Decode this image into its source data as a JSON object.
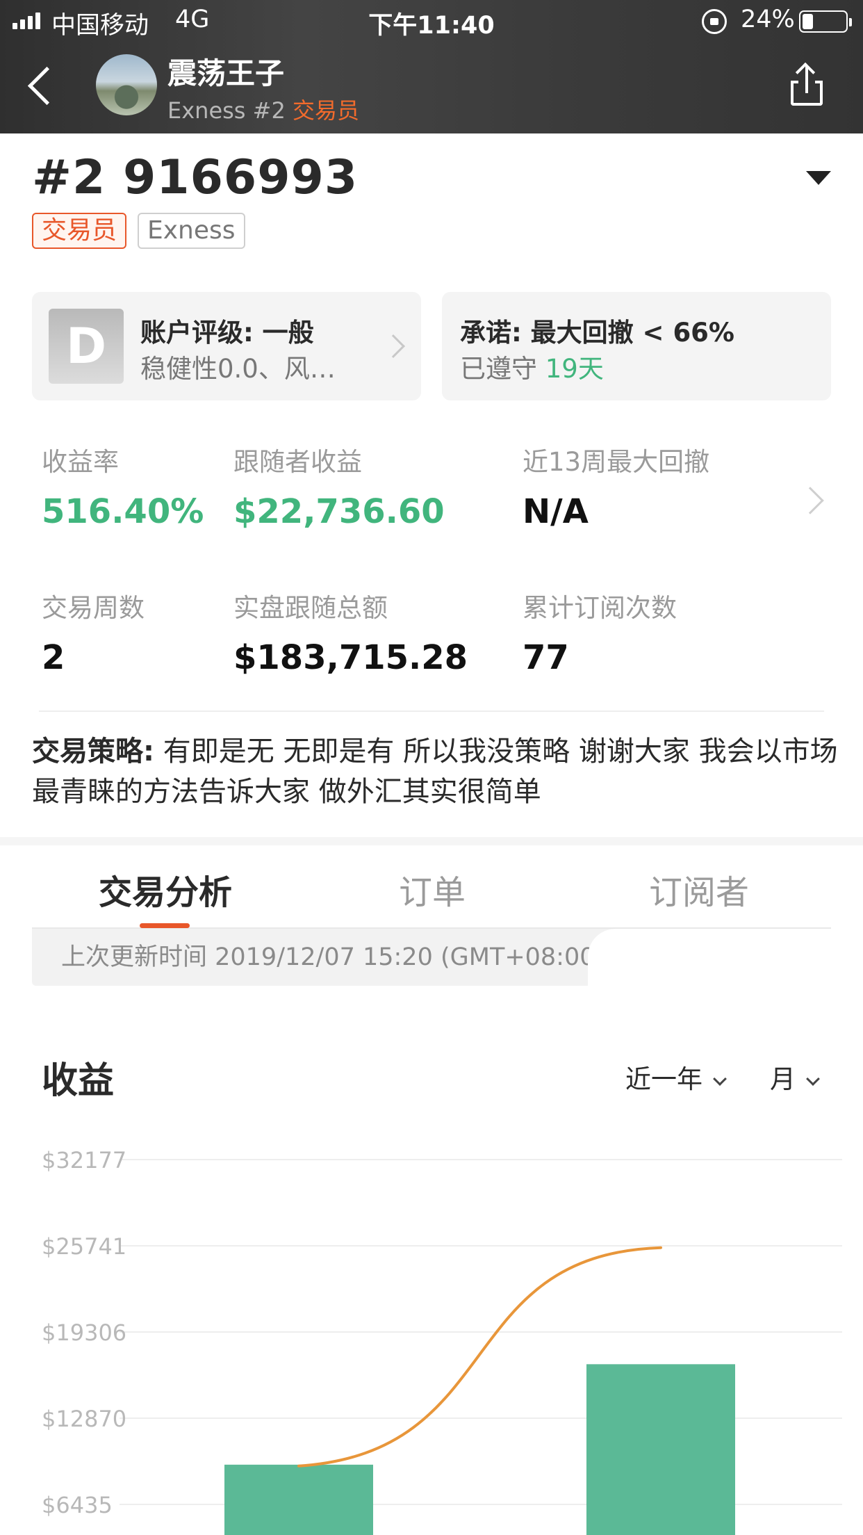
{
  "status_bar": {
    "carrier": "中国移动",
    "network": "4G",
    "time": "下午11:40",
    "battery_text": "24%",
    "battery_level": 0.24
  },
  "nav": {
    "trader_name": "震荡王子",
    "subtitle_prefix": "Exness #2 ",
    "subtitle_role": "交易员"
  },
  "account": {
    "title": "#2 9166993",
    "tag_role": "交易员",
    "tag_broker": "Exness"
  },
  "cards": {
    "rating": {
      "grade": "D",
      "title": "账户评级: 一般",
      "subtitle": "稳健性0.0、风…"
    },
    "promise": {
      "title": "承诺: 最大回撤 < 66%",
      "kept_label": "已遵守 ",
      "kept_days": "19天"
    }
  },
  "stats": [
    {
      "label": "收益率",
      "value": "516.40%",
      "color": "#41b57d"
    },
    {
      "label": "跟随者收益",
      "value": "$22,736.60",
      "color": "#41b57d"
    },
    {
      "label": "近13周最大回撤",
      "value": "N/A",
      "color": "#111111"
    },
    {
      "label": "交易周数",
      "value": "2",
      "color": "#111111"
    },
    {
      "label": "实盘跟随总额",
      "value": "$183,715.28",
      "color": "#111111"
    },
    {
      "label": "累计订阅次数",
      "value": "77",
      "color": "#111111"
    }
  ],
  "strategy": {
    "label": "交易策略:",
    "text": " 有即是无 无即是有 所以我没策略 谢谢大家 我会以市场最青睐的方法告诉大家 做外汇其实很简单"
  },
  "tabs": [
    {
      "label": "交易分析",
      "active": true
    },
    {
      "label": "订单",
      "active": false
    },
    {
      "label": "订阅者",
      "active": false
    }
  ],
  "update_time": "上次更新时间 2019/12/07 15:20 (GMT+08:00)",
  "chart_section": {
    "title": "收益",
    "range_select": "近一年",
    "period_select": "月"
  },
  "chart_data": {
    "type": "bar",
    "title": "收益",
    "y_ticks": [
      32177,
      25741,
      19306,
      12870,
      6435
    ],
    "y_tick_labels": [
      "$32177",
      "$25741",
      "$19306",
      "$12870",
      "$6435"
    ],
    "bar_values": [
      9400,
      16900
    ],
    "line_values": [
      9300,
      25600
    ],
    "bar_color": "#5bb996",
    "line_color": "#e8963a",
    "grid": true
  },
  "colors": {
    "accent": "#e8572a",
    "positive": "#41b57d"
  }
}
